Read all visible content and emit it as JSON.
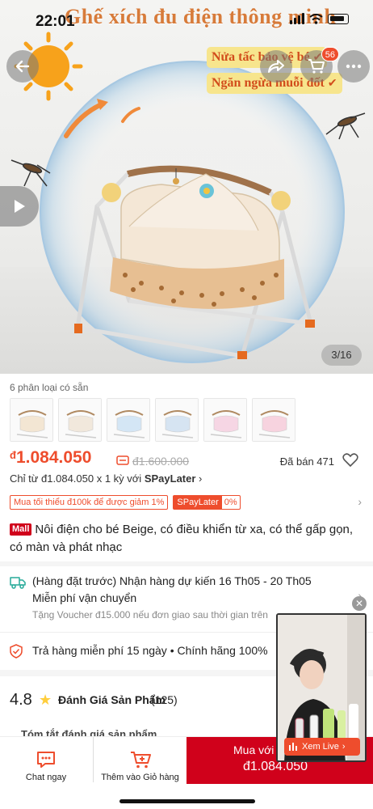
{
  "status_bar": {
    "time": "22:01"
  },
  "hero": {
    "banner_title": "Ghế xích đu điện thông minh",
    "taglines": [
      "Nửa tấc bảo vệ bé",
      "Ngăn ngừa muỗi đốt"
    ],
    "cart_badge": "56",
    "image_counter": "3/16"
  },
  "variants": {
    "label": "6 phân loại có sẵn",
    "items": [
      {
        "color": "#f3e6d3"
      },
      {
        "color": "#f1e8dc"
      },
      {
        "color": "#d4e6f5"
      },
      {
        "color": "#d6e4f2"
      },
      {
        "color": "#f6d6e4"
      },
      {
        "color": "#f7d3df"
      }
    ]
  },
  "price": {
    "currency": "đ",
    "current": "1.084.050",
    "old": "đ1.600.000",
    "sold": "Đã bán 471"
  },
  "installment": {
    "prefix": "Chỉ từ đ1.084.050 x 1 kỳ với",
    "provider": "SPayLater"
  },
  "promos": {
    "min_order": "Mua tối thiểu đ100k để được giảm 1%",
    "spay_label": "SPayLater",
    "spay_rate": "0%"
  },
  "product": {
    "mall_badge": "Mall",
    "title": "Nôi điện cho bé Beige, có điều khiển từ xa, có thể gấp gọn, có màn và phát nhạc"
  },
  "shipping": {
    "line1": "(Hàng đặt trước) Nhận hàng dự kiến 16 Th05 - 20 Th05",
    "line2": "Miễn phí vận chuyển",
    "line3": "Tặng Voucher đ15.000 nếu đơn giao sau thời gian trên"
  },
  "return_policy": {
    "text": "Trả hàng miễn phí 15 ngày  •  Chính hãng 100%"
  },
  "rating": {
    "score": "4.8",
    "title": "Đánh Giá Sản Phẩm",
    "count": "(125)"
  },
  "review_summary": {
    "text": "Tóm tắt đánh giá sản phẩm"
  },
  "live": {
    "button": "Xem Live"
  },
  "bottom_bar": {
    "chat": "Chat ngay",
    "add_cart": "Thêm vào Giỏ hàng",
    "buy_label": "Mua với",
    "buy_price": "đ1.084.050"
  },
  "colors": {
    "accent": "#ee4d2d",
    "mall_red": "#d0011b",
    "star": "#ffce3d"
  }
}
